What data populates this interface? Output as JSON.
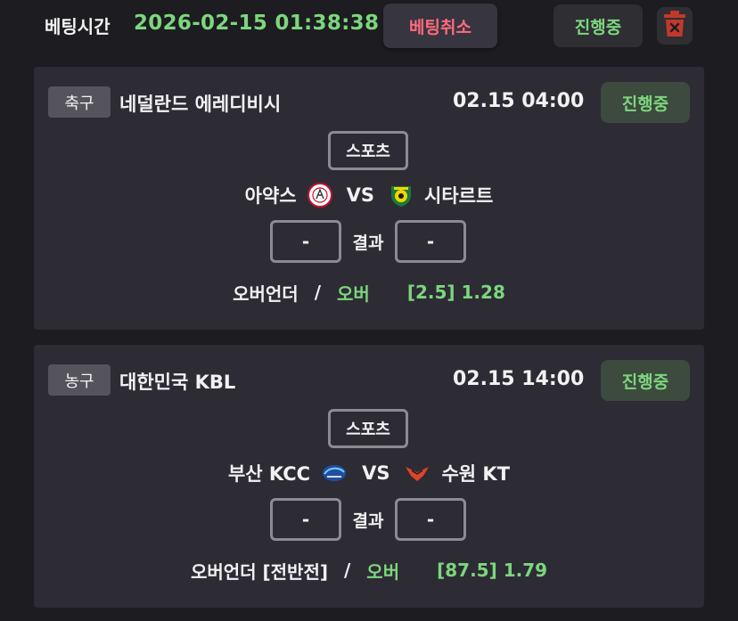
{
  "header": {
    "label": "베팅시간",
    "time": "2026-02-15 01:38:38",
    "cancel_label": "베팅취소",
    "status": "진행중",
    "trash_icon": "trash-icon"
  },
  "colors": {
    "background": "#1c1c21",
    "card": "#2d2c35",
    "accent_green": "#7dd67d",
    "cancel_red": "#ff6b7a",
    "trash_red": "#c0392b"
  },
  "bets": [
    {
      "category": "축구",
      "league": "네덜란드 에레디비시",
      "datetime": "02.15 04:00",
      "status": "진행중",
      "sport_tag": "스포츠",
      "home": "아약스",
      "away": "시타르트",
      "home_logo": "ajax-logo",
      "away_logo": "fortuna-sittard-logo",
      "vs": "VS",
      "score_label": "결과",
      "home_score": "-",
      "away_score": "-",
      "bet_type": "오버언더",
      "separator": "/",
      "pick": "오버",
      "odds": "[2.5] 1.28"
    },
    {
      "category": "농구",
      "league": "대한민국 KBL",
      "datetime": "02.15 14:00",
      "status": "진행중",
      "sport_tag": "스포츠",
      "home": "부산 KCC",
      "away": "수원 KT",
      "home_logo": "busan-kcc-logo",
      "away_logo": "suwon-kt-logo",
      "vs": "VS",
      "score_label": "결과",
      "home_score": "-",
      "away_score": "-",
      "bet_type": "오버언더 [전반전]",
      "separator": "/",
      "pick": "오버",
      "odds": "[87.5] 1.79"
    }
  ]
}
